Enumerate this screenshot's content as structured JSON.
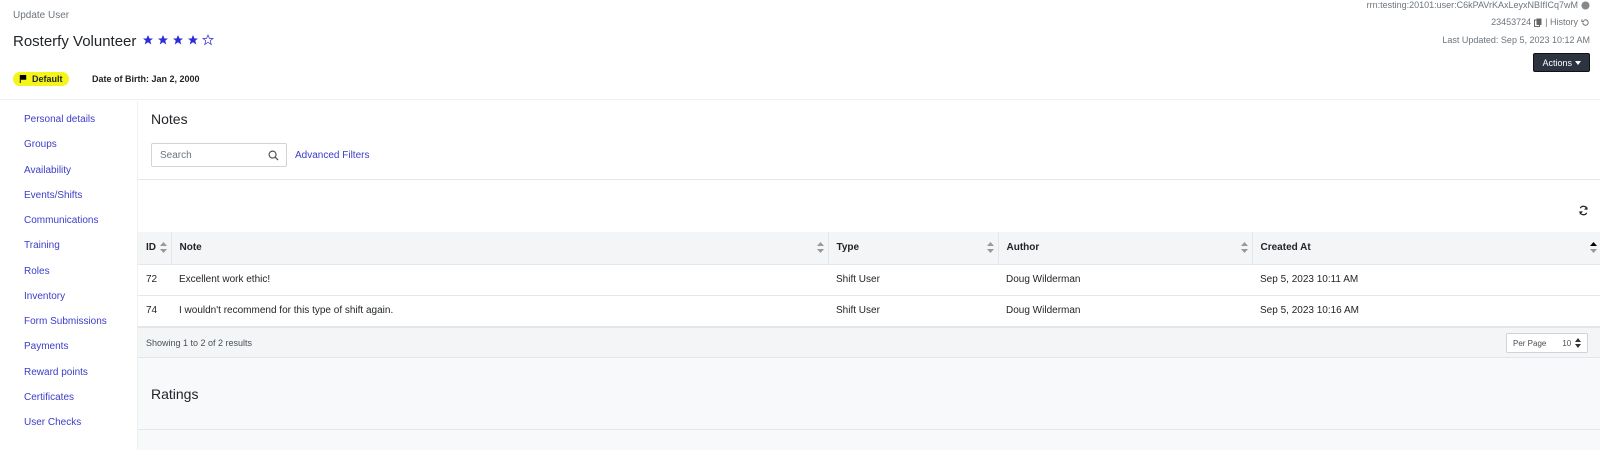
{
  "header": {
    "subtitle": "Update User",
    "user_name": "Rosterfy Volunteer",
    "rating": 4,
    "rating_max": 5,
    "badge": "Default",
    "dob": "Date of Birth: Jan 2, 2000",
    "rrn": "rrn:testing:20101:user:C6kPAVrKAxLeyxNBIfICq7wM",
    "user_id": "23453724",
    "history_label": "| History",
    "last_updated": "Last Updated: Sep 5, 2023 10:12 AM",
    "actions_label": "Actions"
  },
  "sidebar": {
    "items": [
      {
        "label": "Personal details"
      },
      {
        "label": "Groups"
      },
      {
        "label": "Availability"
      },
      {
        "label": "Events/Shifts"
      },
      {
        "label": "Communications"
      },
      {
        "label": "Training"
      },
      {
        "label": "Roles"
      },
      {
        "label": "Inventory"
      },
      {
        "label": "Form Submissions"
      },
      {
        "label": "Payments"
      },
      {
        "label": "Reward points"
      },
      {
        "label": "Certificates"
      },
      {
        "label": "User Checks"
      }
    ]
  },
  "notes": {
    "title": "Notes",
    "search_placeholder": "Search",
    "advanced_filters": "Advanced Filters",
    "columns": [
      "ID",
      "Note",
      "Type",
      "Author",
      "Created At"
    ],
    "rows": [
      {
        "id": "72",
        "note": "Excellent work ethic!",
        "type": "Shift User",
        "author": "Doug Wilderman",
        "created": "Sep 5, 2023 10:11 AM"
      },
      {
        "id": "74",
        "note": "I wouldn't recommend for this type of shift again.",
        "type": "Shift User",
        "author": "Doug Wilderman",
        "created": "Sep 5, 2023 10:16 AM"
      }
    ],
    "showing": "Showing 1 to 2 of 2 results",
    "per_page_label": "Per Page",
    "per_page_value": "10"
  },
  "ratings": {
    "title": "Ratings"
  },
  "colors": {
    "link": "#3c3cc9",
    "star": "#2d2dd6",
    "badge_bg": "#f5f51c",
    "actions_bg": "#2b3440"
  }
}
